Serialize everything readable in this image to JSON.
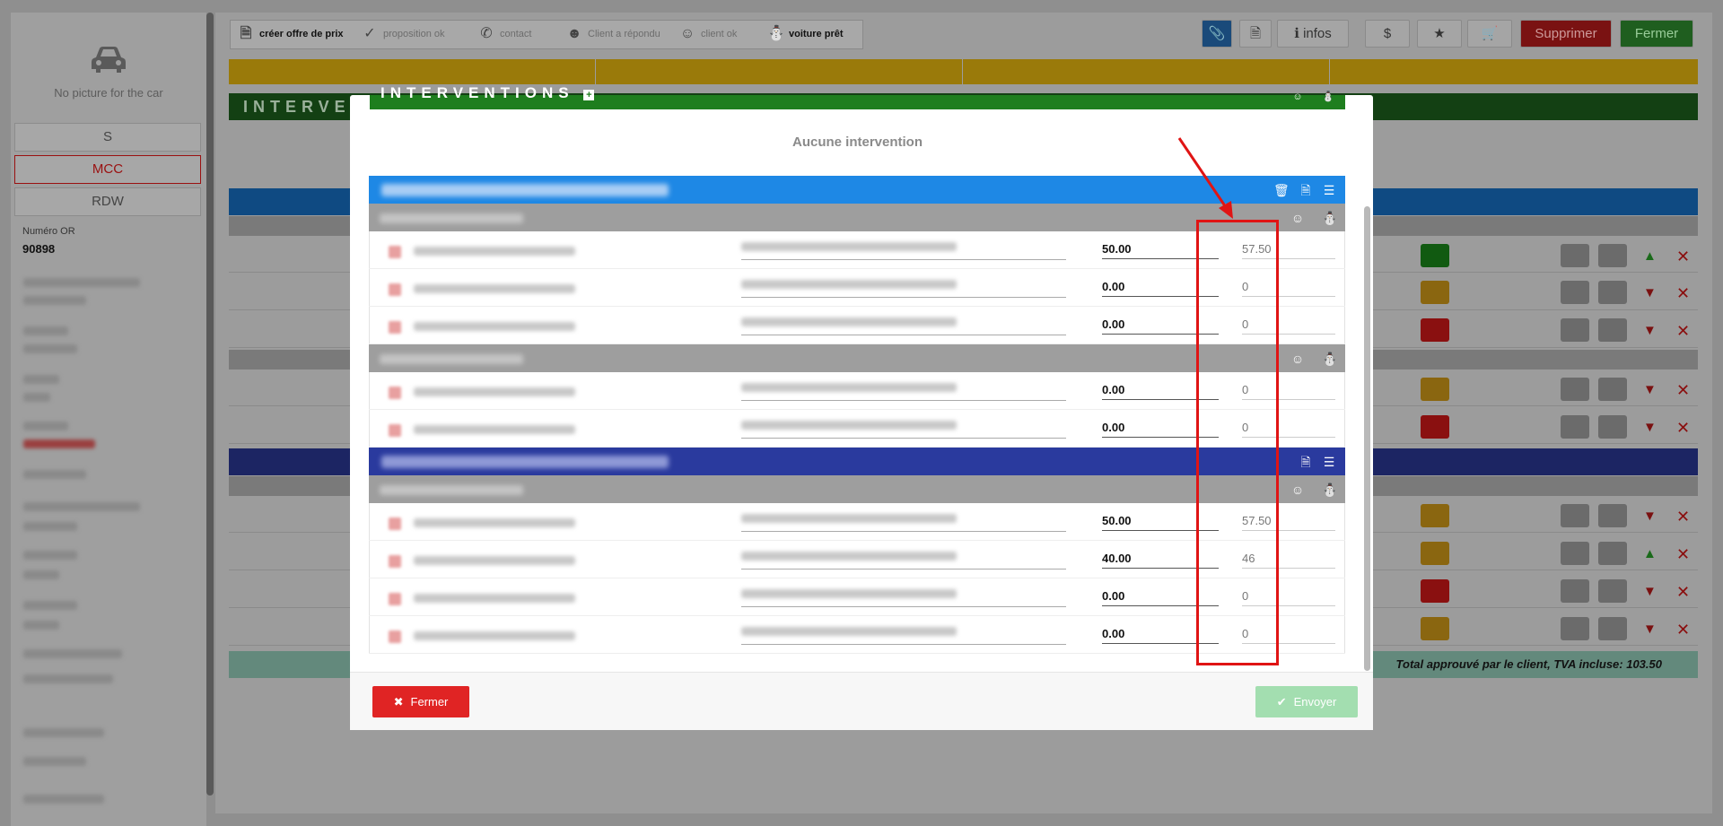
{
  "sidebar": {
    "no_picture": "No picture for the car",
    "buttons": [
      "S",
      "MCC",
      "RDW"
    ],
    "or_label": "Numéro OR",
    "or_value": "90898"
  },
  "steps": [
    {
      "label": "créer offre de prix",
      "icon": "document-icon",
      "done": true
    },
    {
      "label": "proposition ok",
      "icon": "check-icon",
      "done": false
    },
    {
      "label": "contact",
      "icon": "phone-icon",
      "done": false
    },
    {
      "label": "Client a répondu",
      "icon": "user-icon",
      "done": false
    },
    {
      "label": "client ok",
      "icon": "smile-icon",
      "done": false
    },
    {
      "label": "voiture prêt",
      "icon": "car-icon",
      "done": true
    }
  ],
  "toolbar": {
    "infos_label": "infos",
    "supprimer_label": "Supprimer",
    "fermer_label": "Fermer"
  },
  "background": {
    "interventions_title": "INTERVENT",
    "total_text": "Total approuvé par le client, TVA incluse: 103.50"
  },
  "modal": {
    "interventions_title": "INTERVENTIONS",
    "empty_text": "Aucune intervention",
    "groups": [
      {
        "color": "#1e88e5",
        "subgroups": [
          {
            "rows": [
              {
                "price": "50.00",
                "total": "57.50"
              },
              {
                "price": "0.00",
                "total": "0"
              },
              {
                "price": "0.00",
                "total": "0"
              }
            ]
          },
          {
            "rows": [
              {
                "price": "0.00",
                "total": "0"
              },
              {
                "price": "0.00",
                "total": "0"
              }
            ]
          }
        ]
      },
      {
        "color": "#2a3a9e",
        "subgroups": [
          {
            "rows": [
              {
                "price": "50.00",
                "total": "57.50"
              },
              {
                "price": "40.00",
                "total": "46"
              },
              {
                "price": "0.00",
                "total": "0"
              },
              {
                "price": "0.00",
                "total": "0"
              }
            ]
          }
        ]
      }
    ],
    "footer": {
      "close_label": "Fermer",
      "send_label": "Envoyer"
    }
  },
  "colors": {
    "danger": "#e02424",
    "success_disabled": "#a3deb0",
    "green_header": "#1e7e1e",
    "blue_header": "#1e88e5",
    "indigo_header": "#2a3a9e",
    "annotation_red": "#e01414"
  }
}
